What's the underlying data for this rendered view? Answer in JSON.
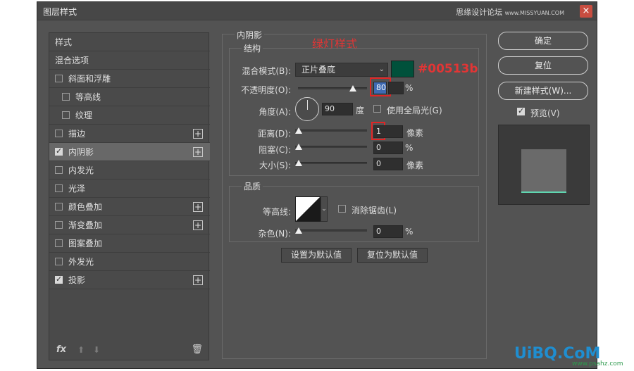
{
  "window": {
    "title": "图层样式",
    "watermark": "思缘设计论坛",
    "watermark_small": "www.MISSYUAN.COM",
    "close": "×"
  },
  "styles_list": {
    "items": [
      {
        "label": "样式",
        "checkbox": false,
        "checked": false,
        "plus": false,
        "indent": 0
      },
      {
        "label": "混合选项",
        "checkbox": false,
        "checked": false,
        "plus": false,
        "indent": 0
      },
      {
        "label": "斜面和浮雕",
        "checkbox": true,
        "checked": false,
        "plus": false,
        "indent": 0
      },
      {
        "label": "等高线",
        "checkbox": true,
        "checked": false,
        "plus": false,
        "indent": 1
      },
      {
        "label": "纹理",
        "checkbox": true,
        "checked": false,
        "plus": false,
        "indent": 1
      },
      {
        "label": "描边",
        "checkbox": true,
        "checked": false,
        "plus": true,
        "indent": 0
      },
      {
        "label": "内阴影",
        "checkbox": true,
        "checked": true,
        "plus": true,
        "indent": 0,
        "selected": true
      },
      {
        "label": "内发光",
        "checkbox": true,
        "checked": false,
        "plus": false,
        "indent": 0
      },
      {
        "label": "光泽",
        "checkbox": true,
        "checked": false,
        "plus": false,
        "indent": 0
      },
      {
        "label": "颜色叠加",
        "checkbox": true,
        "checked": false,
        "plus": true,
        "indent": 0
      },
      {
        "label": "渐变叠加",
        "checkbox": true,
        "checked": false,
        "plus": true,
        "indent": 0
      },
      {
        "label": "图案叠加",
        "checkbox": true,
        "checked": false,
        "plus": false,
        "indent": 0
      },
      {
        "label": "外发光",
        "checkbox": true,
        "checked": false,
        "plus": false,
        "indent": 0
      },
      {
        "label": "投影",
        "checkbox": true,
        "checked": true,
        "plus": true,
        "indent": 0
      }
    ],
    "footer": {
      "fx": "fx",
      "trash_icon": "trash-icon",
      "up_icon": "arrow-up-icon",
      "down_icon": "arrow-down-icon"
    }
  },
  "inner_shadow": {
    "section_title": "内阴影",
    "annotation": "绿灯样式",
    "structure": {
      "title": "结构",
      "blend_mode_label": "混合模式(B):",
      "blend_mode_value": "正片叠底",
      "color_hex": "#00513b",
      "color_annotation": "#00513b",
      "opacity_label": "不透明度(O):",
      "opacity_value": "80",
      "opacity_unit": "%",
      "angle_label": "角度(A):",
      "angle_value": "90",
      "angle_unit": "度",
      "global_light_label": "使用全局光(G)",
      "global_light_checked": false,
      "distance_label": "距离(D):",
      "distance_value": "1",
      "distance_unit": "像素",
      "choke_label": "阻塞(C):",
      "choke_value": "0",
      "choke_unit": "%",
      "size_label": "大小(S):",
      "size_value": "0",
      "size_unit": "像素"
    },
    "quality": {
      "title": "品质",
      "contour_label": "等高线:",
      "anti_alias_label": "消除锯齿(L)",
      "anti_alias_checked": false,
      "noise_label": "杂色(N):",
      "noise_value": "0",
      "noise_unit": "%"
    },
    "set_default": "设置为默认值",
    "reset_default": "复位为默认值"
  },
  "right": {
    "ok": "确定",
    "reset": "复位",
    "new_style": "新建样式(W)...",
    "preview_label": "预览(V)",
    "preview_checked": true
  },
  "branding": {
    "logo": "UiBQ.CoM",
    "logo_sub": "www.psahz.com"
  }
}
